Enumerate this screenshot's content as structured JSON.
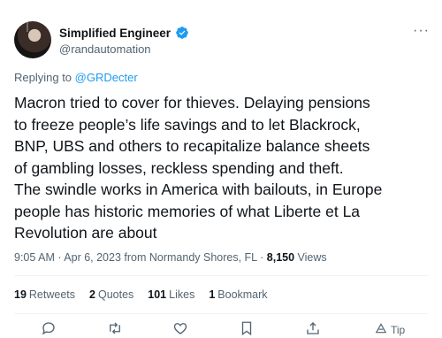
{
  "author": {
    "display_name": "Simplified Engineer",
    "handle": "@randautomation",
    "avatar_icon": "avatar-photo",
    "verified_icon": "verified-badge-icon"
  },
  "replying": {
    "prefix": "Replying to ",
    "mention": "@GRDecter"
  },
  "tweet": {
    "text": "Macron tried to cover for thieves. Delaying pensions\nto freeze people’s life savings and to let Blackrock,\nBNP, UBS and others to recapitalize balance sheets\nof gambling losses, reckless spending and theft.\nThe swindle works in America with bailouts, in Europe\npeople has historic memories of what Liberte et La\nRevolution are about"
  },
  "meta": {
    "timestamp": "9:05 AM · Apr 6, 2023 from Normandy Shores, FL · ",
    "views_count": "8,150",
    "views_label": " Views"
  },
  "stats": {
    "retweets": {
      "count": "19",
      "label": "Retweets"
    },
    "quotes": {
      "count": "2",
      "label": "Quotes"
    },
    "likes": {
      "count": "101",
      "label": "Likes"
    },
    "bookmarks": {
      "count": "1",
      "label": "Bookmark"
    }
  },
  "actions": {
    "tip_label": "Tip",
    "icons": [
      "reply-icon",
      "retweet-icon",
      "like-icon",
      "bookmark-icon",
      "share-icon",
      "tip-icon"
    ]
  },
  "colors": {
    "accent": "#1d9bf0",
    "text_primary": "#0f1419",
    "text_secondary": "#536471",
    "divider": "#eff3f4"
  }
}
